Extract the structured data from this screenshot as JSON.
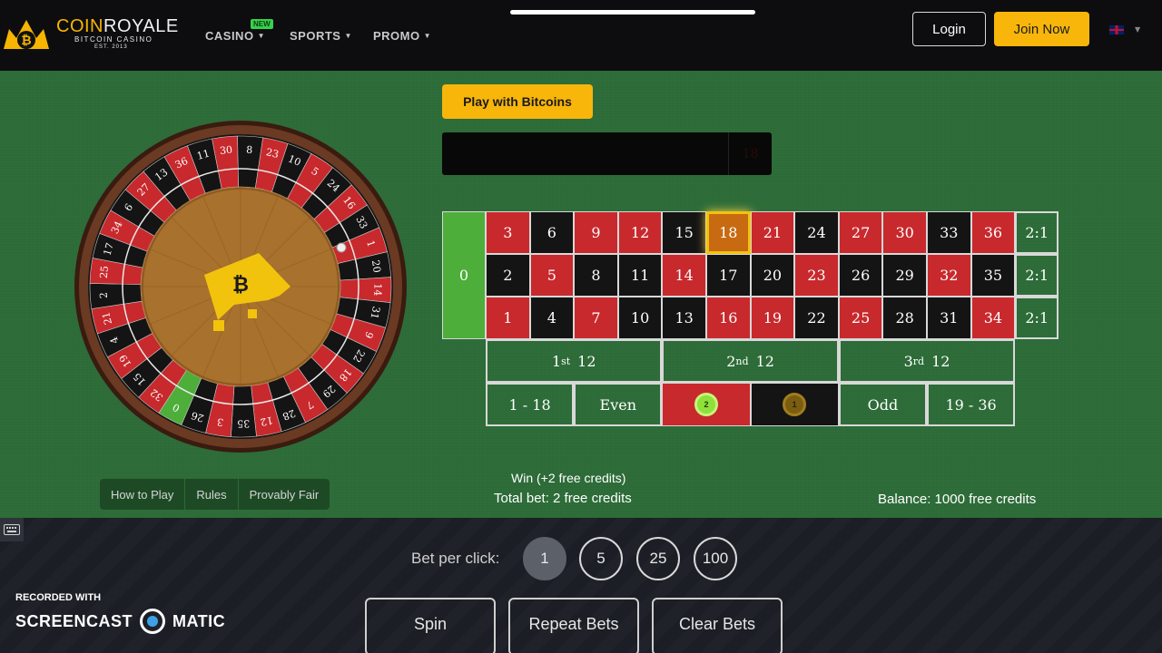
{
  "header": {
    "logo_brand_1": "COIN",
    "logo_brand_2": "ROYALE",
    "logo_sub": "BITCOIN CASINO",
    "logo_est": "EST. 2013",
    "nav": [
      {
        "label": "CASINO",
        "badge": "NEW"
      },
      {
        "label": "SPORTS"
      },
      {
        "label": "PROMO"
      }
    ],
    "login_label": "Login",
    "join_label": "Join Now",
    "language_icon": "uk-flag-icon"
  },
  "game": {
    "play_btc_label": "Play with Bitcoins",
    "last_result": "18",
    "board": {
      "zero": "0",
      "rows": [
        [
          "3",
          "6",
          "9",
          "12",
          "15",
          "18",
          "21",
          "24",
          "27",
          "30",
          "33",
          "36"
        ],
        [
          "2",
          "5",
          "8",
          "11",
          "14",
          "17",
          "20",
          "23",
          "26",
          "29",
          "32",
          "35"
        ],
        [
          "1",
          "4",
          "7",
          "10",
          "13",
          "16",
          "19",
          "22",
          "25",
          "28",
          "31",
          "34"
        ]
      ],
      "colors": [
        [
          "red",
          "black",
          "red",
          "red",
          "black",
          "red",
          "red",
          "black",
          "red",
          "red",
          "black",
          "red"
        ],
        [
          "black",
          "red",
          "black",
          "black",
          "red",
          "black",
          "black",
          "red",
          "black",
          "black",
          "red",
          "black"
        ],
        [
          "red",
          "black",
          "red",
          "black",
          "black",
          "red",
          "red",
          "black",
          "red",
          "black",
          "black",
          "red"
        ]
      ],
      "highlighted": "18",
      "column_bets": [
        "2:1",
        "2:1",
        "2:1"
      ],
      "dozens": [
        {
          "n": "1",
          "sup": "st",
          "tail": "12"
        },
        {
          "n": "2",
          "sup": "nd",
          "tail": "12"
        },
        {
          "n": "3",
          "sup": "rd",
          "tail": "12"
        }
      ],
      "even_money": {
        "low": "1 - 18",
        "even": "Even",
        "red_chip": "2",
        "black_chip": "1",
        "odd": "Odd",
        "high": "19 - 36"
      }
    },
    "wheel_numbers": [
      "0",
      "32",
      "15",
      "19",
      "4",
      "21",
      "2",
      "25",
      "17",
      "34",
      "6",
      "27",
      "13",
      "36",
      "11",
      "30",
      "8",
      "23",
      "10",
      "5",
      "24",
      "16",
      "33",
      "1",
      "20",
      "14",
      "31",
      "9",
      "22",
      "18",
      "29",
      "7",
      "28",
      "12",
      "35",
      "3",
      "26"
    ],
    "tabs": [
      "How to Play",
      "Rules",
      "Provably Fair"
    ],
    "status_win": "Win (+2 free credits)",
    "status_total": "Total bet: 2 free credits",
    "status_balance": "Balance: 1000 free credits"
  },
  "controls": {
    "bet_label": "Bet per click:",
    "bet_options": [
      "1",
      "5",
      "25",
      "100"
    ],
    "bet_selected": "1",
    "spin_label": "Spin",
    "repeat_label": "Repeat Bets",
    "clear_label": "Clear Bets"
  },
  "watermark": {
    "recorded_with": "RECORDED WITH",
    "brand_1": "SCREENCAST",
    "brand_2": "MATIC"
  },
  "colors": {
    "felt": "#2c6b37",
    "gold": "#f8b60b",
    "red": "#c8292d",
    "black": "#141414",
    "green": "#4dae3a"
  }
}
